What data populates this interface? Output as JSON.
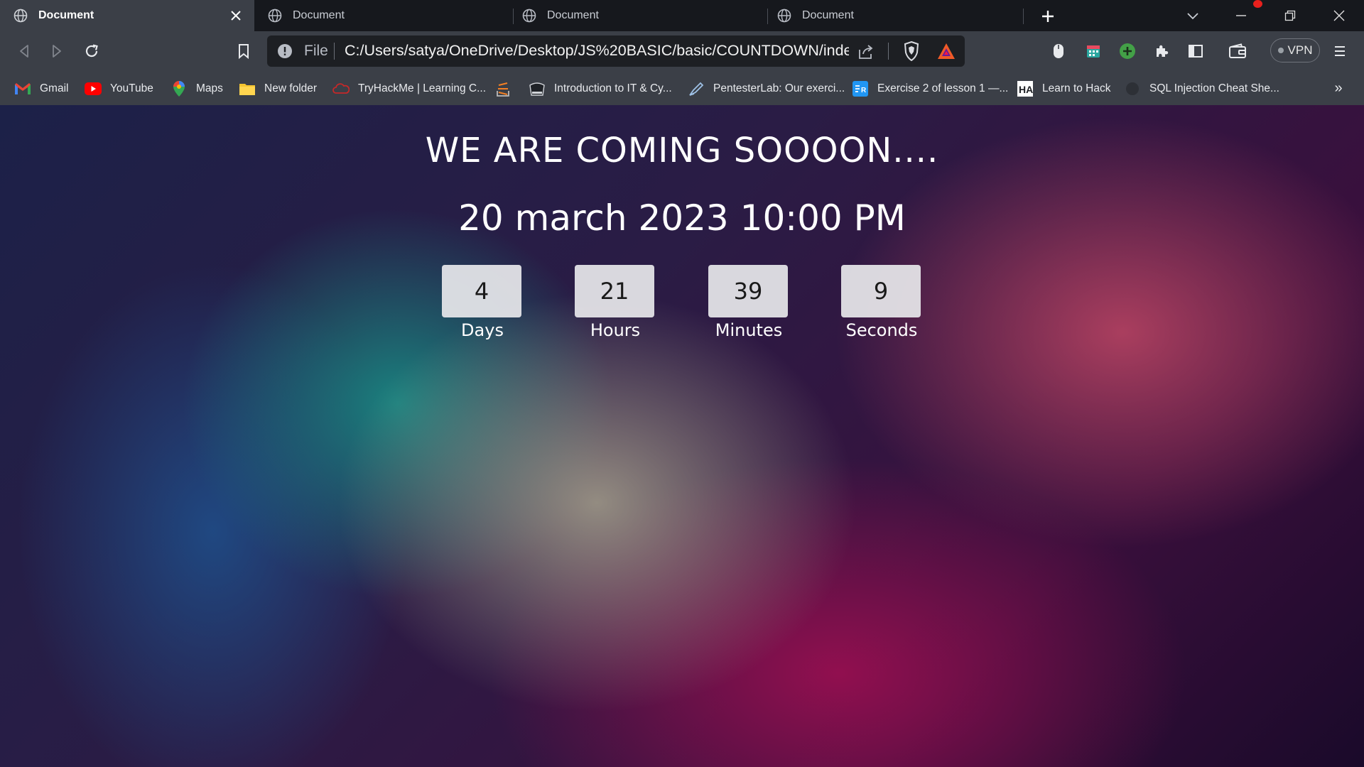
{
  "tabs": [
    {
      "title": "Document",
      "active": true
    },
    {
      "title": "Document",
      "active": false
    },
    {
      "title": "Document",
      "active": false
    },
    {
      "title": "Document",
      "active": false
    }
  ],
  "omnibox": {
    "scheme_label": "File",
    "url": "C:/Users/satya/OneDrive/Desktop/JS%20BASIC/basic/COUNTDOWN/index..."
  },
  "vpn_label": "VPN",
  "bookmarks": [
    {
      "label": "Gmail",
      "icon": "gmail-icon"
    },
    {
      "label": "YouTube",
      "icon": "youtube-icon"
    },
    {
      "label": "Maps",
      "icon": "maps-icon"
    },
    {
      "label": "New folder",
      "icon": "folder-icon"
    },
    {
      "label": "TryHackMe | Learning C...",
      "icon": "tryhackme-icon"
    },
    {
      "label": "",
      "icon": "stack-icon"
    },
    {
      "label": "Introduction to IT & Cy...",
      "icon": "cybrary-icon"
    },
    {
      "label": "PentesterLab: Our exerci...",
      "icon": "pentesterlab-icon"
    },
    {
      "label": "Exercise 2 of lesson 1 —...",
      "icon": "exercise-icon"
    },
    {
      "label": "Learn to Hack",
      "icon": "hackaday-icon"
    },
    {
      "label": "SQL Injection Cheat She...",
      "icon": "sql-icon"
    }
  ],
  "page": {
    "title": "WE ARE COMING SOOOON....",
    "date": "20 march 2023 10:00 PM",
    "counters": [
      {
        "value": "4",
        "label": "Days"
      },
      {
        "value": "21",
        "label": "Hours"
      },
      {
        "value": "39",
        "label": "Minutes"
      },
      {
        "value": "9",
        "label": "Seconds"
      }
    ]
  },
  "colors": {
    "tabbar_bg": "#16181d",
    "toolbar_bg": "#3b3f47",
    "omnibox_bg": "#1d1f23",
    "counter_box_bg": "#e8e8ec"
  }
}
